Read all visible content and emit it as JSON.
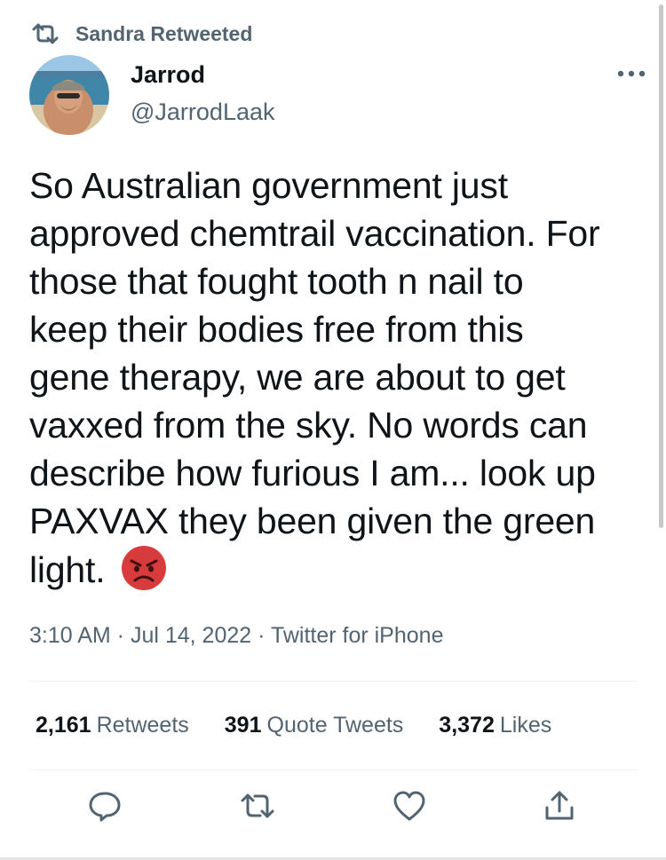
{
  "retweet_banner": {
    "icon": "retweet-icon",
    "label": "Sandra Retweeted"
  },
  "author": {
    "display_name": "Jarrod",
    "handle": "@JarrodLaak",
    "avatar": "beach-selfie-avatar"
  },
  "more_icon": "more-horizontal-icon",
  "tweet": {
    "text": "So Australian government just\napproved chemtrail vaccination. For\nthose that fought tooth n nail to\nkeep their bodies free from this\ngene therapy, we are about to get\nvaxxed from the sky. No words can\ndescribe how furious I am... look up\nPAXVAX they been given the green\nlight. ",
    "emoji": "angry-face-emoji"
  },
  "meta": {
    "time": "3:10 AM",
    "separator": " · ",
    "date": "Jul 14, 2022",
    "source": "Twitter for iPhone"
  },
  "stats": {
    "retweets": {
      "count": "2,161",
      "label": "Retweets"
    },
    "quote_tweets": {
      "count": "391",
      "label": "Quote Tweets"
    },
    "likes": {
      "count": "3,372",
      "label": "Likes"
    }
  },
  "actions": [
    "reply-icon",
    "retweet-icon",
    "like-icon",
    "share-icon"
  ],
  "colors": {
    "text": "#0f1419",
    "secondary": "#536471",
    "divider": "#eff3f4",
    "emoji_red": "#d83b3b"
  }
}
